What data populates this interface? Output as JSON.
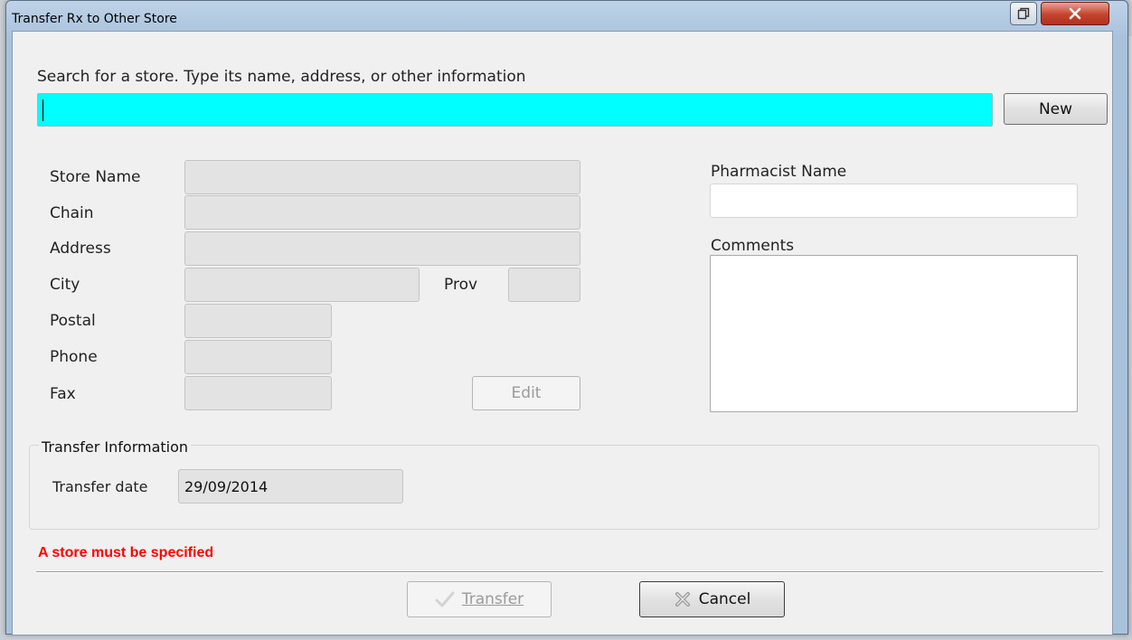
{
  "window": {
    "title": "Transfer Rx to Other Store",
    "accent_color": "#00ffff",
    "error_color": "#ff0000"
  },
  "search": {
    "prompt": "Search for a store.  Type its name, address, or other information",
    "value": "",
    "new_label": "New"
  },
  "store": {
    "name_label": "Store Name",
    "chain_label": "Chain",
    "address_label": "Address",
    "city_label": "City",
    "prov_label": "Prov",
    "postal_label": "Postal",
    "phone_label": "Phone",
    "fax_label": "Fax",
    "edit_label": "Edit"
  },
  "pharmacist": {
    "label": "Pharmacist Name",
    "value": ""
  },
  "comments": {
    "label": "Comments",
    "value": ""
  },
  "transfer_info": {
    "group_title": "Transfer Information",
    "date_label": "Transfer date",
    "date_value": "29/09/2014"
  },
  "status": {
    "error": "A store must be specified"
  },
  "actions": {
    "transfer_label": "Transfer",
    "cancel_label": "Cancel"
  },
  "icons": {
    "restore": "restore-icon",
    "close": "close-x-icon",
    "transfer": "checkmark-icon",
    "cancel": "cross-icon"
  }
}
